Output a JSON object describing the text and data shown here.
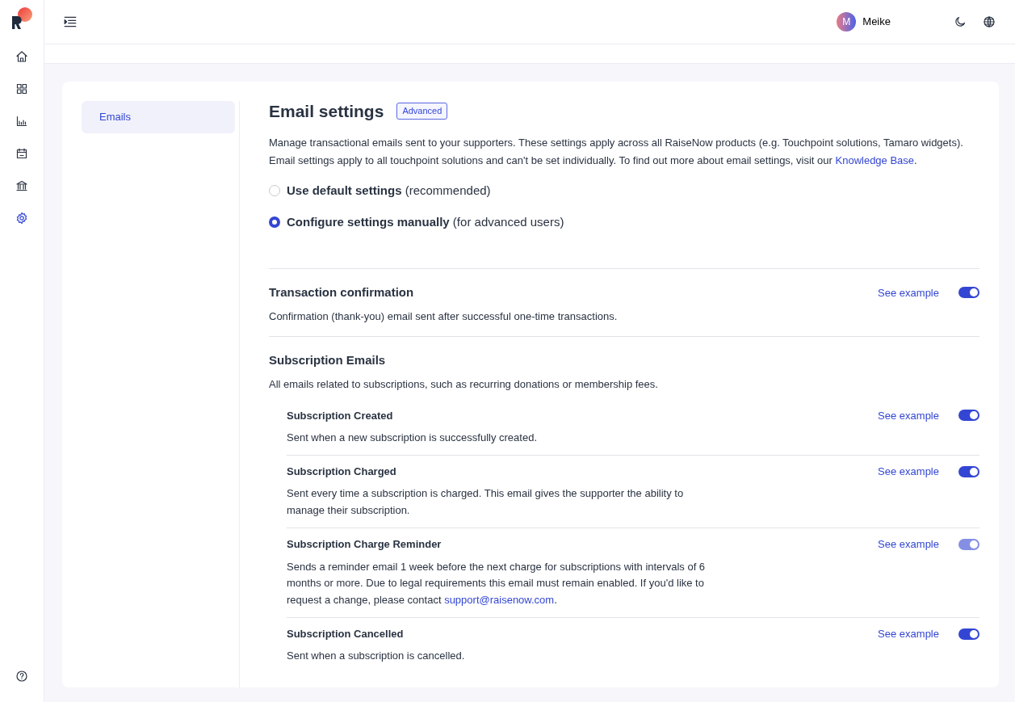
{
  "sidebar": {
    "items": [
      {
        "kind": "home",
        "selected": false
      },
      {
        "kind": "grid",
        "selected": false
      },
      {
        "kind": "chart",
        "selected": false
      },
      {
        "kind": "calendar",
        "selected": false
      },
      {
        "kind": "bank",
        "selected": false
      },
      {
        "kind": "gear",
        "selected": true
      }
    ]
  },
  "topbar": {
    "user": {
      "initial": "M",
      "name": "Meike"
    }
  },
  "settings_nav": [
    {
      "label": "Emails",
      "selected": true
    }
  ],
  "page": {
    "title": "Email settings",
    "badge": "Advanced",
    "description": "Manage transactional emails sent to your supporters. These settings apply across all RaiseNow products (e.g. Touchpoint solutions, Tamaro widgets). Email settings apply to all touchpoint solutions and can't be set individually. To find out more about email settings, visit our ",
    "description_link": "Knowledge Base",
    "description_end": ".",
    "options": [
      {
        "label": "**Use default settings** (recommended)",
        "selected": false
      },
      {
        "label": "**Configure settings manually** (for advanced users)",
        "selected": true
      }
    ]
  },
  "sections": [
    {
      "title": "Transaction confirmation",
      "description": "Confirmation (thank-you) email sent after successful one-time transactions.",
      "example": "See example",
      "on": true,
      "disabled": false
    },
    {
      "title": "Subscription Emails",
      "description": "All emails related to subscriptions, such as recurring donations or membership fees.",
      "items": [
        {
          "title": "Subscription Created",
          "description": "Sent when a new subscription is successfully created.",
          "example": "See example",
          "on": true,
          "disabled": false
        },
        {
          "title": "Subscription Charged",
          "description": "Sent every time a subscription is charged. This email gives the supporter the ability to manage their subscription.",
          "example": "See example",
          "on": true,
          "disabled": false
        },
        {
          "title": "Subscription Charge Reminder",
          "description": "Sends a reminder email 1 week before the next charge for subscriptions with intervals of 6 months or more. Due to legal requirements this email must remain enabled. If you'd like to request a change, please contact ",
          "link": "support@raisenow.com",
          "description_end": ".",
          "example": "See example",
          "on": true,
          "disabled": true
        },
        {
          "title": "Subscription Cancelled",
          "description": "Sent when a subscription is cancelled.",
          "example": "See example",
          "on": true,
          "disabled": false
        }
      ]
    }
  ]
}
